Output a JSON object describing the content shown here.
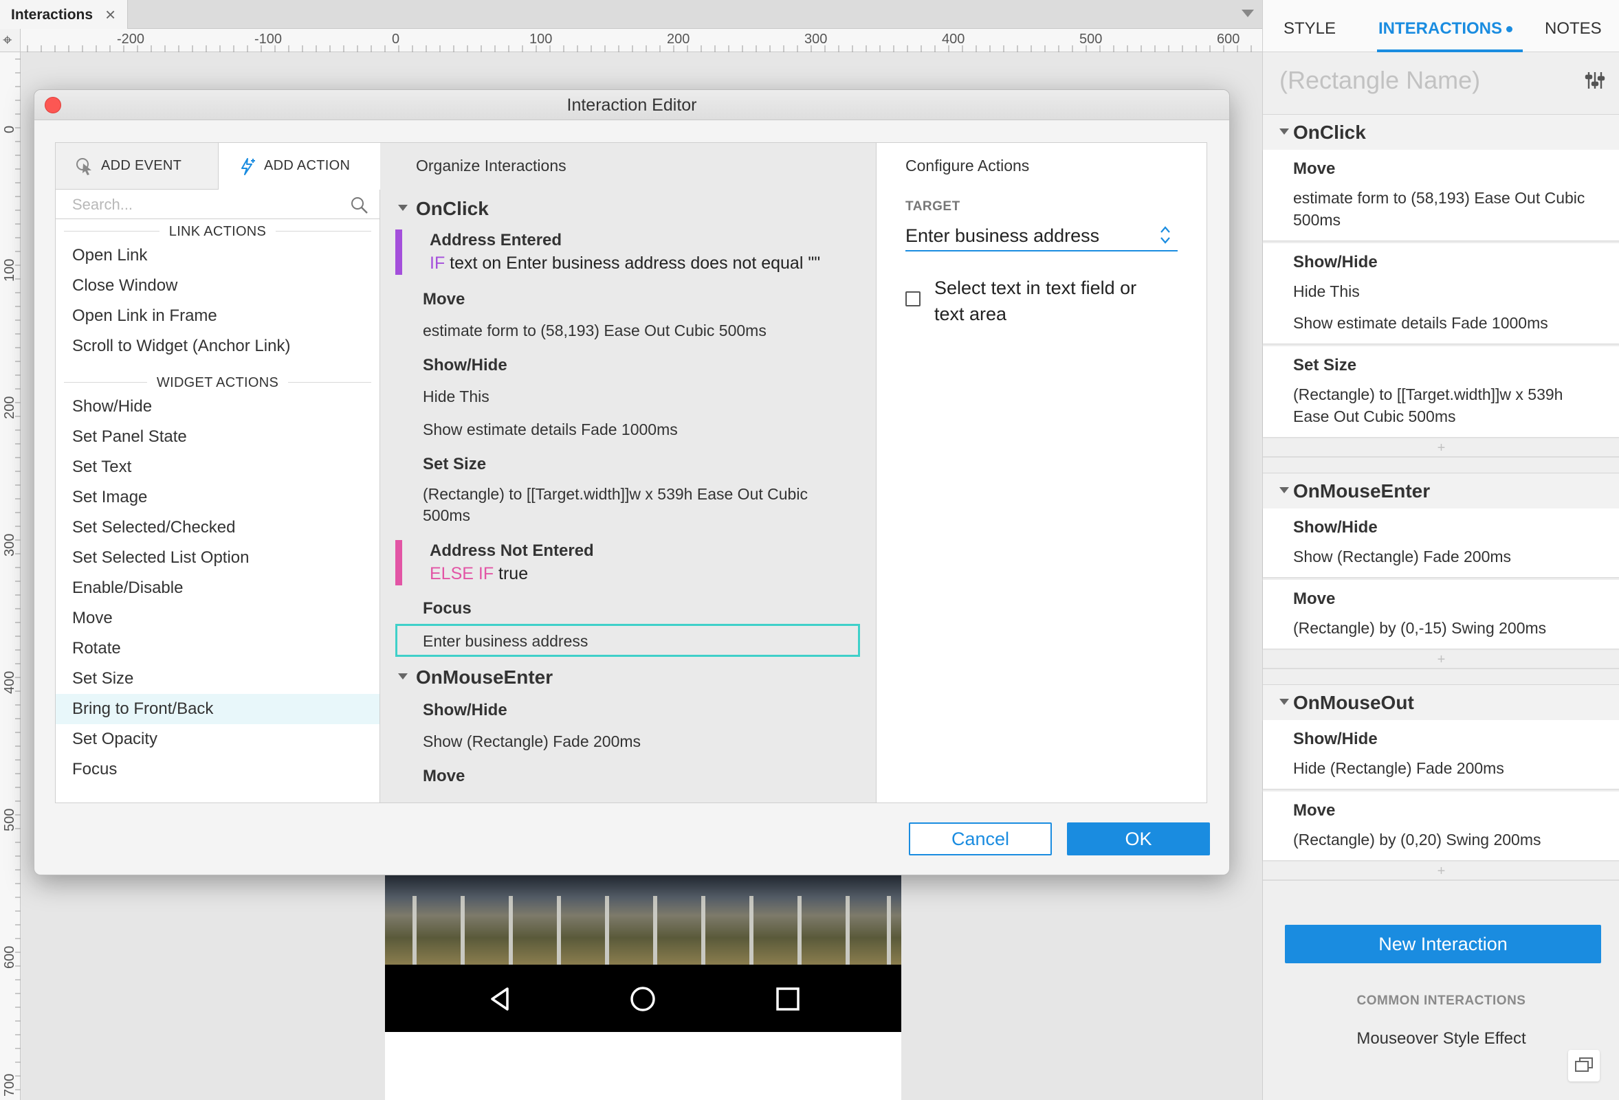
{
  "document_tab": {
    "title": "Interactions",
    "close_glyph": "×"
  },
  "rulers": {
    "h_labels": [
      "-200",
      "-100",
      "0",
      "100",
      "200",
      "300",
      "400",
      "500",
      "600"
    ],
    "v_labels": [
      "0",
      "100",
      "200",
      "300",
      "400",
      "500",
      "600",
      "700"
    ],
    "corner_glyph": "⌖"
  },
  "right_panel": {
    "tabs": [
      "STYLE",
      "INTERACTIONS",
      "NOTES"
    ],
    "active_tab": "INTERACTIONS",
    "widget_name_placeholder": "(Rectangle Name)",
    "events": [
      {
        "name": "OnClick",
        "cards": [
          {
            "heading": "Move",
            "details": [
              "estimate form to (58,193) Ease Out Cubic 500ms"
            ]
          },
          {
            "heading": "Show/Hide",
            "details": [
              "Hide This",
              "Show estimate details Fade 1000ms"
            ]
          },
          {
            "heading": "Set Size",
            "details": [
              "(Rectangle) to [[Target.width]]w x 539h Ease Out Cubic 500ms"
            ]
          }
        ]
      },
      {
        "name": "OnMouseEnter",
        "cards": [
          {
            "heading": "Show/Hide",
            "details": [
              "Show (Rectangle) Fade 200ms"
            ]
          },
          {
            "heading": "Move",
            "details": [
              "(Rectangle) by (0,-15) Swing 200ms"
            ]
          }
        ]
      },
      {
        "name": "OnMouseOut",
        "cards": [
          {
            "heading": "Show/Hide",
            "details": [
              "Hide (Rectangle) Fade 200ms"
            ]
          },
          {
            "heading": "Move",
            "details": [
              "(Rectangle) by (0,20) Swing 200ms"
            ]
          }
        ]
      }
    ],
    "add_glyph": "+",
    "new_interaction_label": "New Interaction",
    "common_heading": "COMMON INTERACTIONS",
    "common_item": "Mouseover Style Effect"
  },
  "dialog": {
    "title": "Interaction Editor",
    "add_event_label": "ADD EVENT",
    "add_action_label": "ADD ACTION",
    "search_placeholder": "Search...",
    "link_actions_heading": "LINK ACTIONS",
    "link_actions": [
      "Open Link",
      "Close Window",
      "Open Link in Frame",
      "Scroll to Widget (Anchor Link)"
    ],
    "widget_actions_heading": "WIDGET ACTIONS",
    "widget_actions": [
      "Show/Hide",
      "Set Panel State",
      "Set Text",
      "Set Image",
      "Set Selected/Checked",
      "Set Selected List Option",
      "Enable/Disable",
      "Move",
      "Rotate",
      "Set Size",
      "Bring to Front/Back",
      "Set Opacity",
      "Focus"
    ],
    "highlighted_action": "Bring to Front/Back",
    "organize": {
      "heading": "Organize Interactions",
      "event1": "OnClick",
      "cond1_name": "Address Entered",
      "cond1_kw": "IF",
      "cond1_text": " text on Enter business address does not equal \"\"",
      "move_h": "Move",
      "move_d": "estimate form to (58,193) Ease Out Cubic 500ms",
      "showhide_h": "Show/Hide",
      "showhide_d1": "Hide This",
      "showhide_d2": "Show estimate details Fade 1000ms",
      "setsize_h": "Set Size",
      "setsize_d": "(Rectangle) to [[Target.width]]w x 539h Ease Out Cubic 500ms",
      "cond2_name": "Address Not Entered",
      "cond2_kw": "ELSE IF",
      "cond2_text": " true",
      "focus_h": "Focus",
      "focus_d": "Enter business address",
      "event2": "OnMouseEnter",
      "e2_showhide_h": "Show/Hide",
      "e2_showhide_d": "Show (Rectangle) Fade 200ms",
      "e2_move_h": "Move"
    },
    "configure": {
      "heading": "Configure Actions",
      "target_label": "TARGET",
      "target_value": "Enter business address",
      "checkbox_label": "Select text in text field or text area",
      "checkbox_checked": false
    },
    "cancel_label": "Cancel",
    "ok_label": "OK"
  },
  "colors": {
    "accent": "#1a8ce0",
    "if_condition": "#a44fdb",
    "else_condition": "#e255a5",
    "selection": "#3fd0c9",
    "close_button": "#fc5753"
  }
}
